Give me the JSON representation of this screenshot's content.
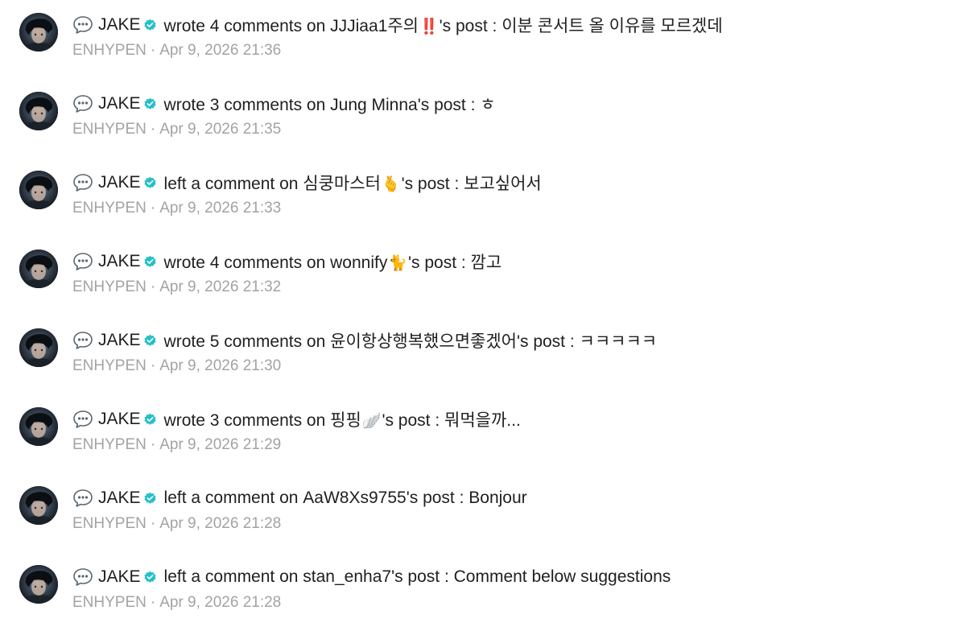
{
  "colors": {
    "text": "#1f1f1f",
    "meta": "#a3a3a3",
    "verified": "#24c0c9"
  },
  "icons": {
    "speech": "speech-bubble-icon",
    "verified": "verified-badge-icon"
  },
  "feed": [
    {
      "author": "JAKE",
      "action": "wrote 4 comments on",
      "target": "JJJiaa1주의",
      "emoji": "‼️",
      "suffix": "'s post : 이분 콘서트 올 이유를 모르겠데",
      "community": "ENHYPEN",
      "time": "Apr 9, 2026 21:36"
    },
    {
      "author": "JAKE",
      "action": "wrote 3 comments on",
      "target": "Jung Minna",
      "emoji": "",
      "suffix": "'s post : ㅎ",
      "community": "ENHYPEN",
      "time": "Apr 9, 2026 21:35"
    },
    {
      "author": "JAKE",
      "action": "left a comment on",
      "target": "심쿵마스터",
      "emoji": "🫰",
      "suffix": "'s post : 보고싶어서",
      "community": "ENHYPEN",
      "time": "Apr 9, 2026 21:33"
    },
    {
      "author": "JAKE",
      "action": "wrote 4 comments on",
      "target": "wonnify",
      "emoji": "🐈",
      "suffix": "'s post : 깜고",
      "community": "ENHYPEN",
      "time": "Apr 9, 2026 21:32"
    },
    {
      "author": "JAKE",
      "action": "wrote 5 comments on",
      "target": "윤이항상행복했으면좋겠어",
      "emoji": "",
      "suffix": "'s post : ㅋㅋㅋㅋㅋ",
      "community": "ENHYPEN",
      "time": "Apr 9, 2026 21:30"
    },
    {
      "author": "JAKE",
      "action": "wrote 3 comments on",
      "target": "핑핑",
      "emoji": "🪽",
      "suffix": "'s post : 뭐먹을까...",
      "community": "ENHYPEN",
      "time": "Apr 9, 2026 21:29"
    },
    {
      "author": "JAKE",
      "action": "left a comment on",
      "target": "AaW8Xs9755",
      "emoji": "",
      "suffix": "'s post : Bonjour",
      "community": "ENHYPEN",
      "time": "Apr 9, 2026 21:28"
    },
    {
      "author": "JAKE",
      "action": "left a comment on",
      "target": "stan_enha7",
      "emoji": "",
      "suffix": "'s post : Comment below suggestions",
      "community": "ENHYPEN",
      "time": "Apr 9, 2026 21:28"
    }
  ]
}
